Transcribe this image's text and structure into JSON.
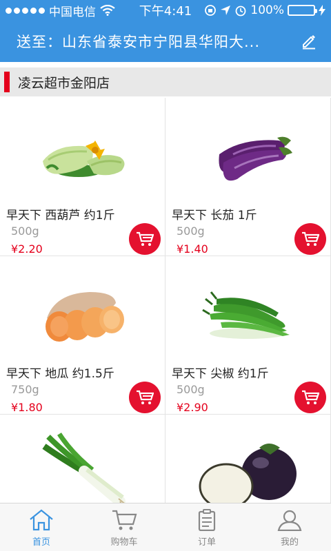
{
  "status": {
    "carrier": "中国电信",
    "time": "下午4:41",
    "battery": "100%",
    "battery_level": 1.0,
    "signal_icon": "signal-dots-icon",
    "wifi_icon": "wifi-icon"
  },
  "header": {
    "delivery_address": "送至：山东省泰安市宁阳县华阳大...",
    "edit_icon": "edit-pencil-icon",
    "color": "#3a93e0"
  },
  "store": {
    "name": "凌云超市金阳店",
    "accent": "#e4001c"
  },
  "products": [
    {
      "name": "早天下 西葫芦 约1斤",
      "weight": "500g",
      "price": "¥2.20",
      "image": "zucchini"
    },
    {
      "name": "早天下 长茄 1斤",
      "weight": "500g",
      "price": "¥1.40",
      "image": "eggplant"
    },
    {
      "name": "早天下 地瓜 约1.5斤",
      "weight": "750g",
      "price": "¥1.80",
      "image": "sweet-potato"
    },
    {
      "name": "早天下 尖椒 约1斤",
      "weight": "500g",
      "price": "¥2.90",
      "image": "green-pepper"
    },
    {
      "name": "",
      "weight": "",
      "price": "",
      "image": "scallion"
    },
    {
      "name": "",
      "weight": "",
      "price": "",
      "image": "round-eggplant"
    }
  ],
  "tabs": [
    {
      "label": "首页",
      "icon": "home-icon",
      "active": true
    },
    {
      "label": "购物车",
      "icon": "cart-icon",
      "active": false
    },
    {
      "label": "订单",
      "icon": "order-list-icon",
      "active": false
    },
    {
      "label": "我的",
      "icon": "user-icon",
      "active": false
    }
  ]
}
